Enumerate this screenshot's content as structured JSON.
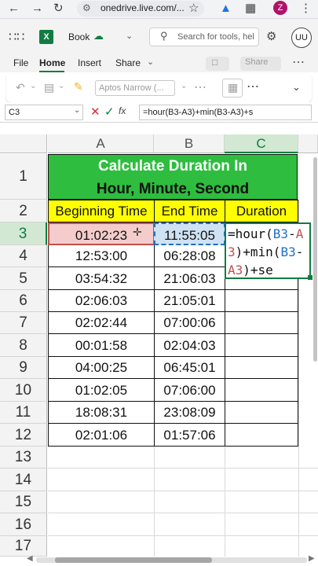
{
  "browser": {
    "url": "onedrive.live.com/...",
    "profile_initial": "Z"
  },
  "app": {
    "title": "Book",
    "search_placeholder": "Search for tools, hel",
    "user_initials": "UU",
    "excel_letter": "X"
  },
  "menu": [
    "File",
    "Home",
    "Insert",
    "Share"
  ],
  "ribbon": {
    "font_name": "Aptos Narrow (..."
  },
  "formula_bar": {
    "cell_ref": "C3",
    "formula": "=hour(B3-A3)+min(B3-A3)+s"
  },
  "columns": [
    "A",
    "B",
    "C"
  ],
  "rows": [
    "1",
    "2",
    "3",
    "4",
    "5",
    "6",
    "7",
    "8",
    "9",
    "10",
    "11",
    "12",
    "13",
    "14",
    "15",
    "16",
    "17"
  ],
  "sheet": {
    "title_line1": "Calculate Duration In",
    "title_line2": "Hour, Minute, Second",
    "headers": [
      "Beginning Time",
      "End Time",
      "Duration"
    ],
    "data": [
      [
        "01:02:23",
        "11:55:05"
      ],
      [
        "12:53:00",
        "06:28:08"
      ],
      [
        "03:54:32",
        "21:06:03"
      ],
      [
        "02:06:03",
        "21:05:01"
      ],
      [
        "02:02:44",
        "07:00:06"
      ],
      [
        "00:01:58",
        "02:04:03"
      ],
      [
        "04:00:25",
        "06:45:01"
      ],
      [
        "01:02:05",
        "07:06:00"
      ],
      [
        "18:08:31",
        "23:08:09"
      ],
      [
        "02:01:06",
        "01:57:06"
      ]
    ],
    "edit_parts": [
      "=hour(",
      "B3",
      "-",
      "A3",
      ")+min(",
      "B3",
      "-",
      "A3",
      ")+se"
    ]
  },
  "colors": {
    "title_bg": "#2ebd3f",
    "header_bg": "#ffff00",
    "excel_green": "#107c41",
    "ref_blue": "#1f6fc5",
    "ref_red": "#c0504d"
  }
}
